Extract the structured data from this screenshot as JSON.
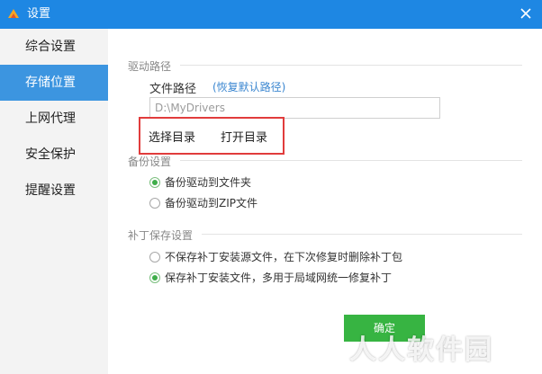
{
  "window": {
    "title": "设置"
  },
  "sidebar": {
    "items": [
      {
        "label": "综合设置"
      },
      {
        "label": "存储位置"
      },
      {
        "label": "上网代理"
      },
      {
        "label": "安全保护"
      },
      {
        "label": "提醒设置"
      }
    ]
  },
  "driver_path": {
    "section_title": "驱动路径",
    "path_label": "文件路径",
    "restore_link": "(恢复默认路径)",
    "path_value": "D:\\MyDrivers",
    "choose_dir": "选择目录",
    "open_dir": "打开目录"
  },
  "backup": {
    "section_title": "备份设置",
    "options": [
      {
        "label": "备份驱动到文件夹",
        "checked": true
      },
      {
        "label": "备份驱动到ZIP文件",
        "checked": false
      }
    ]
  },
  "patch": {
    "section_title": "补丁保存设置",
    "options": [
      {
        "label": "不保存补丁安装源文件，在下次修复时删除补丁包",
        "checked": false
      },
      {
        "label": "保存补丁安装文件，多用于局域网统一修复补丁",
        "checked": true
      }
    ]
  },
  "footer": {
    "confirm": "确定"
  },
  "watermark": "人人软件园"
}
